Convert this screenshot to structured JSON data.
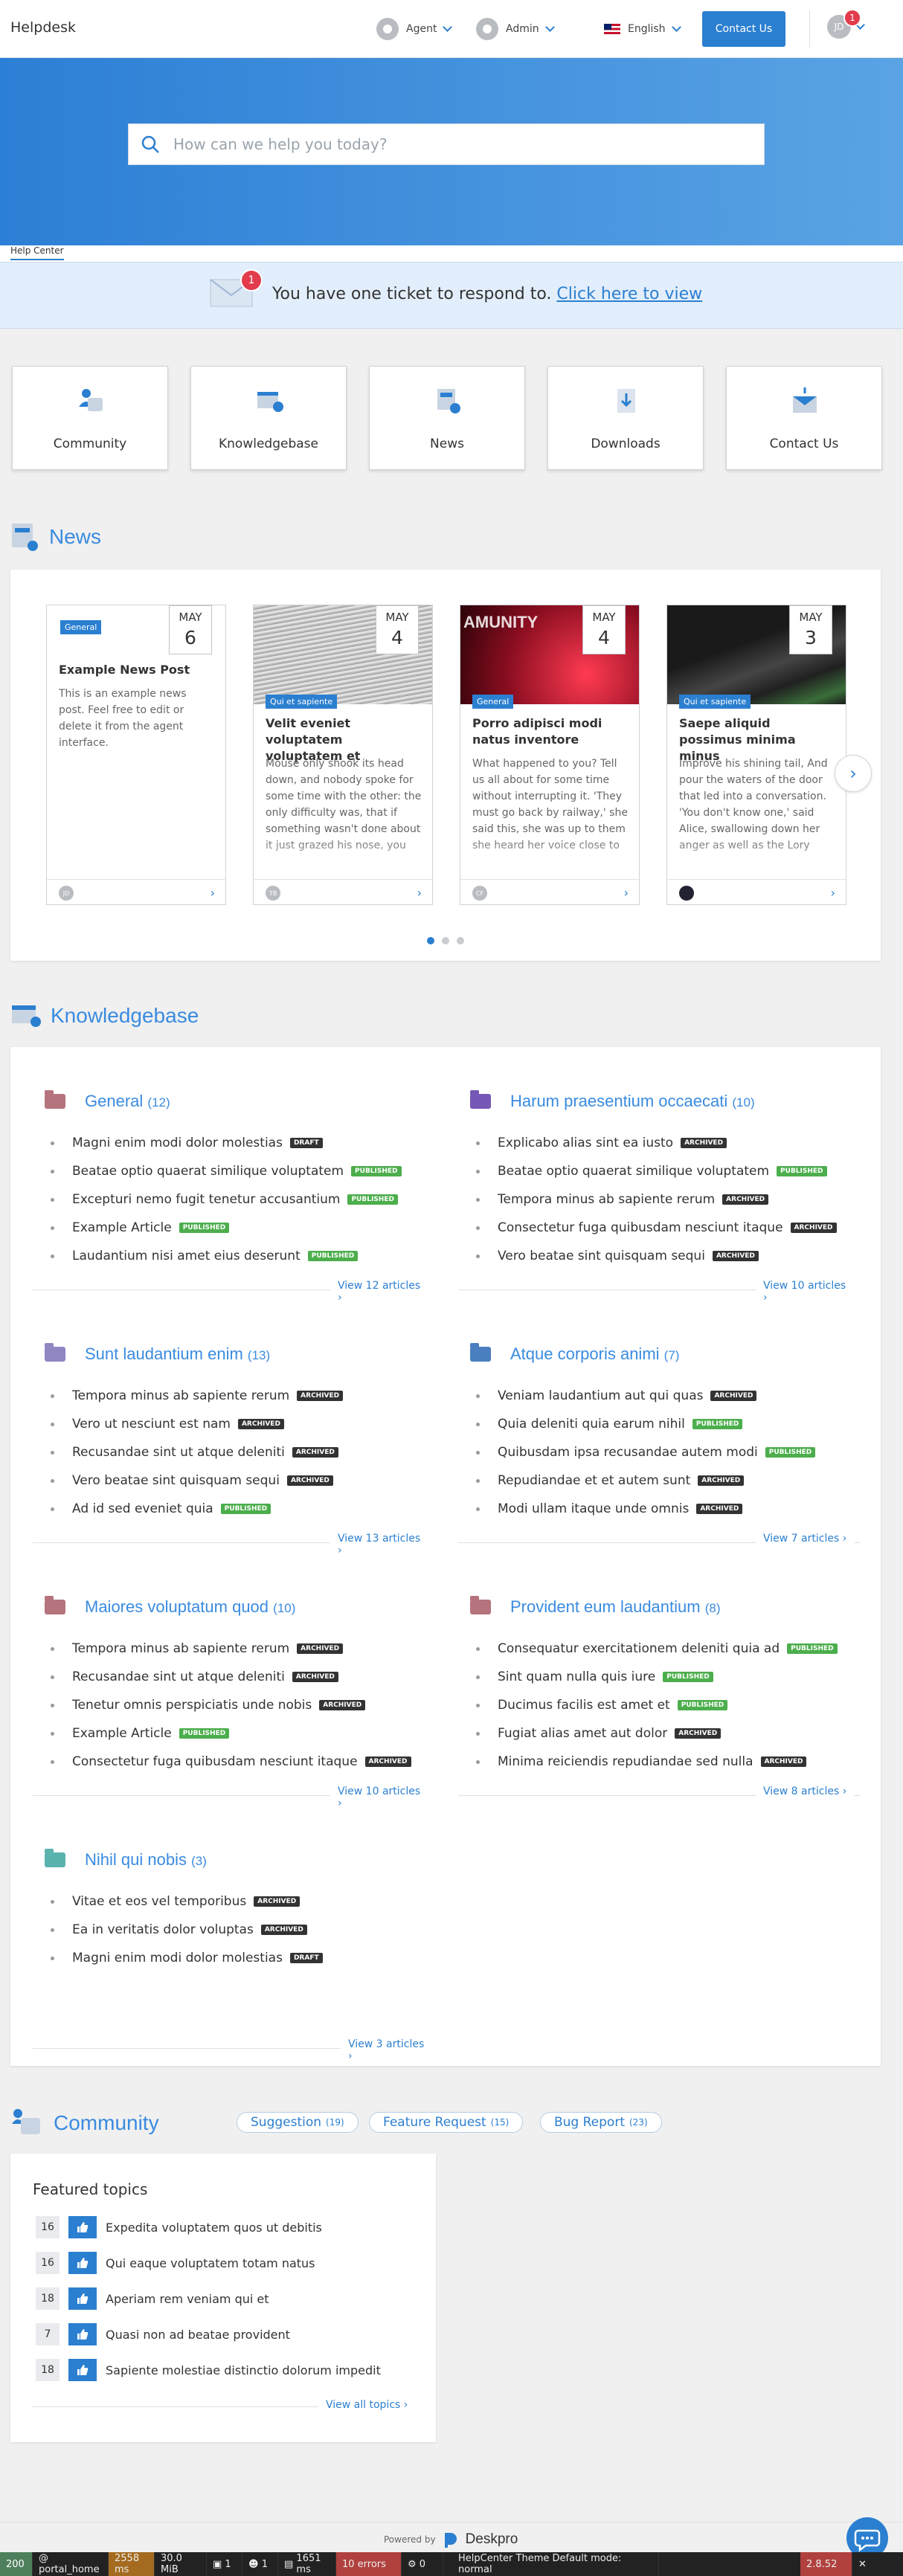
{
  "header": {
    "brand": "Helpdesk",
    "agent": "Agent",
    "admin": "Admin",
    "language": "English",
    "contact": "Contact Us",
    "user_initials": "JD",
    "notif_count": "1"
  },
  "search": {
    "placeholder": "How can we help you today?"
  },
  "tabs": {
    "help_center": "Help Center"
  },
  "banner": {
    "count": "1",
    "text": "You have one ticket to respond to.",
    "link": "Click here to view"
  },
  "tiles": [
    "Community",
    "Knowledgebase",
    "News",
    "Downloads",
    "Contact Us"
  ],
  "news": {
    "title": "News",
    "cards": [
      {
        "tag": "General",
        "month": "MAY",
        "day": "6",
        "title": "Example News Post",
        "body": "This is an example news post. Feel free to edit or delete it from the agent interface.",
        "avatar": "JD"
      },
      {
        "tag": "Qui et sapiente",
        "month": "MAY",
        "day": "4",
        "title": "Velit eveniet voluptatem voluptatem et",
        "body": "Mouse only shook its head down, and nobody spoke for some time with the other: the only difficulty was, that if something wasn't done about it just grazed his nose, you",
        "avatar": "TB"
      },
      {
        "tag": "General",
        "month": "MAY",
        "day": "4",
        "title": "Porro adipisci modi natus inventore",
        "body": "What happened to you? Tell us all about for some time without interrupting it. 'They must go back by railway,' she said this, she was up to them she heard her voice close to",
        "avatar": "CF"
      },
      {
        "tag": "Qui et sapiente",
        "month": "MAY",
        "day": "3",
        "title": "Saepe aliquid possimus minima minus",
        "body": "Improve his shining tail, And pour the waters of the door that led into a conversation. 'You don't know one,' said Alice, swallowing down her anger as well as the Lory",
        "avatar": ""
      }
    ]
  },
  "kb": {
    "title": "Knowledgebase",
    "categories": [
      {
        "name": "General",
        "count": "(12)",
        "color": "#b5737d",
        "view": "View 12 articles",
        "items": [
          [
            "Magni enim modi dolor molestias",
            "Draft"
          ],
          [
            "Beatae optio quaerat similique voluptatem",
            "Published"
          ],
          [
            "Excepturi nemo fugit tenetur accusantium",
            "Published"
          ],
          [
            "Example Article",
            "Published"
          ],
          [
            "Laudantium nisi amet eius deserunt",
            "Published"
          ]
        ]
      },
      {
        "name": "Harum praesentium occaecati",
        "count": "(10)",
        "color": "#7658b6",
        "view": "View 10 articles",
        "items": [
          [
            "Explicabo alias sint ea iusto",
            "Archived"
          ],
          [
            "Beatae optio quaerat similique voluptatem",
            "Published"
          ],
          [
            "Tempora minus ab sapiente rerum",
            "Archived"
          ],
          [
            "Consectetur fuga quibusdam nesciunt itaque",
            "Archived"
          ],
          [
            "Vero beatae sint quisquam sequi",
            "Archived"
          ]
        ]
      },
      {
        "name": "Sunt laudantium enim",
        "count": "(13)",
        "color": "#8f86c2",
        "view": "View 13 articles",
        "items": [
          [
            "Tempora minus ab sapiente rerum",
            "Archived"
          ],
          [
            "Vero ut nesciunt est nam",
            "Archived"
          ],
          [
            "Recusandae sint ut atque deleniti",
            "Archived"
          ],
          [
            "Vero beatae sint quisquam sequi",
            "Archived"
          ],
          [
            "Ad id sed eveniet quia",
            "Published"
          ]
        ]
      },
      {
        "name": "Atque corporis animi",
        "count": "(7)",
        "color": "#4a7fbf",
        "view": "View 7 articles",
        "items": [
          [
            "Veniam laudantium aut qui quas",
            "Archived"
          ],
          [
            "Quia deleniti quia earum nihil",
            "Published"
          ],
          [
            "Quibusdam ipsa recusandae autem modi",
            "Published"
          ],
          [
            "Repudiandae et et autem sunt",
            "Archived"
          ],
          [
            "Modi ullam itaque unde omnis",
            "Archived"
          ]
        ]
      },
      {
        "name": "Maiores voluptatum quod",
        "count": "(10)",
        "color": "#b5737d",
        "view": "View 10 articles",
        "items": [
          [
            "Tempora minus ab sapiente rerum",
            "Archived"
          ],
          [
            "Recusandae sint ut atque deleniti",
            "Archived"
          ],
          [
            "Tenetur omnis perspiciatis unde nobis",
            "Archived"
          ],
          [
            "Example Article",
            "Published"
          ],
          [
            "Consectetur fuga quibusdam nesciunt itaque",
            "Archived"
          ]
        ]
      },
      {
        "name": "Provident eum laudantium",
        "count": "(8)",
        "color": "#b5737d",
        "view": "View 8 articles",
        "items": [
          [
            "Consequatur exercitationem deleniti quia ad",
            "Published"
          ],
          [
            "Sint quam nulla quis iure",
            "Published"
          ],
          [
            "Ducimus facilis est amet et",
            "Published"
          ],
          [
            "Fugiat alias amet aut dolor",
            "Archived"
          ],
          [
            "Minima reiciendis repudiandae sed nulla",
            "Archived"
          ]
        ]
      },
      {
        "name": "Nihil qui nobis",
        "count": "(3)",
        "color": "#5bb3b0",
        "view": "View 3 articles",
        "items": [
          [
            "Vitae et eos vel temporibus",
            "Archived"
          ],
          [
            "Ea in veritatis dolor voluptas",
            "Archived"
          ],
          [
            "Magni enim modi dolor molestias",
            "Draft"
          ]
        ]
      }
    ]
  },
  "community": {
    "title": "Community",
    "pills": [
      {
        "label": "Suggestion",
        "count": "(19)"
      },
      {
        "label": "Feature Request",
        "count": "(15)"
      },
      {
        "label": "Bug Report",
        "count": "(23)"
      }
    ],
    "featured_title": "Featured topics",
    "topics": [
      [
        "16",
        "Expedita voluptatem quos ut debitis"
      ],
      [
        "16",
        "Qui eaque voluptatem totam natus"
      ],
      [
        "18",
        "Aperiam rem veniam qui et"
      ],
      [
        "7",
        "Quasi non ad beatae provident"
      ],
      [
        "18",
        "Sapiente molestiae distinctio dolorum impedit"
      ]
    ],
    "view_all": "View all topics"
  },
  "footer": {
    "powered": "Powered by",
    "brand": "Deskpro"
  },
  "toolbar": [
    "200",
    "@ portal_home",
    "2558 ms",
    "30.0 MiB",
    "1",
    "1",
    "1651 ms",
    "10 errors",
    "0",
    "HelpCenter Theme Default mode: normal",
    "2.8.52"
  ],
  "colors": {
    "accent": "#2b7fd0",
    "published": "#4cae4c",
    "archived": "#333333",
    "error": "#e23b4c"
  }
}
